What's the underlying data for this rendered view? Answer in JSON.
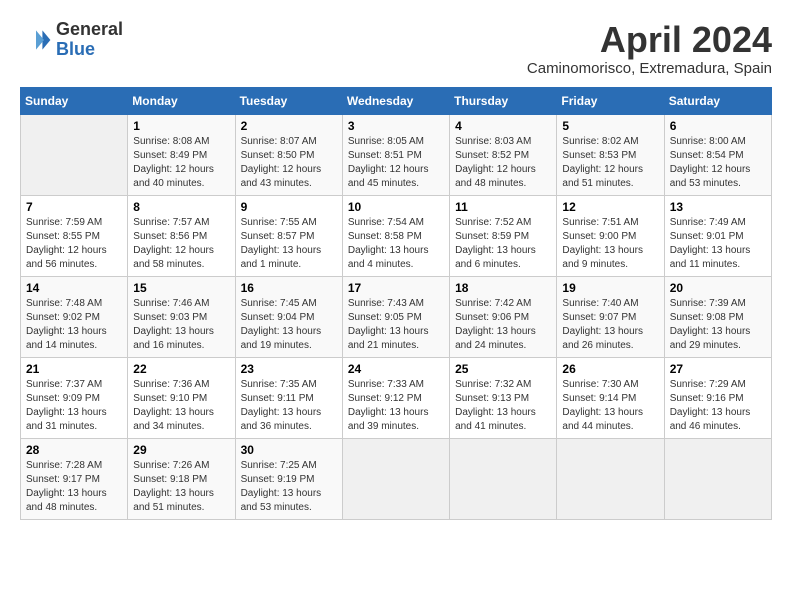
{
  "header": {
    "logo_general": "General",
    "logo_blue": "Blue",
    "month_title": "April 2024",
    "subtitle": "Caminomorisco, Extremadura, Spain"
  },
  "weekdays": [
    "Sunday",
    "Monday",
    "Tuesday",
    "Wednesday",
    "Thursday",
    "Friday",
    "Saturday"
  ],
  "weeks": [
    [
      {
        "day": "",
        "sunrise": "",
        "sunset": "",
        "daylight": ""
      },
      {
        "day": "1",
        "sunrise": "Sunrise: 8:08 AM",
        "sunset": "Sunset: 8:49 PM",
        "daylight": "Daylight: 12 hours and 40 minutes."
      },
      {
        "day": "2",
        "sunrise": "Sunrise: 8:07 AM",
        "sunset": "Sunset: 8:50 PM",
        "daylight": "Daylight: 12 hours and 43 minutes."
      },
      {
        "day": "3",
        "sunrise": "Sunrise: 8:05 AM",
        "sunset": "Sunset: 8:51 PM",
        "daylight": "Daylight: 12 hours and 45 minutes."
      },
      {
        "day": "4",
        "sunrise": "Sunrise: 8:03 AM",
        "sunset": "Sunset: 8:52 PM",
        "daylight": "Daylight: 12 hours and 48 minutes."
      },
      {
        "day": "5",
        "sunrise": "Sunrise: 8:02 AM",
        "sunset": "Sunset: 8:53 PM",
        "daylight": "Daylight: 12 hours and 51 minutes."
      },
      {
        "day": "6",
        "sunrise": "Sunrise: 8:00 AM",
        "sunset": "Sunset: 8:54 PM",
        "daylight": "Daylight: 12 hours and 53 minutes."
      }
    ],
    [
      {
        "day": "7",
        "sunrise": "Sunrise: 7:59 AM",
        "sunset": "Sunset: 8:55 PM",
        "daylight": "Daylight: 12 hours and 56 minutes."
      },
      {
        "day": "8",
        "sunrise": "Sunrise: 7:57 AM",
        "sunset": "Sunset: 8:56 PM",
        "daylight": "Daylight: 12 hours and 58 minutes."
      },
      {
        "day": "9",
        "sunrise": "Sunrise: 7:55 AM",
        "sunset": "Sunset: 8:57 PM",
        "daylight": "Daylight: 13 hours and 1 minute."
      },
      {
        "day": "10",
        "sunrise": "Sunrise: 7:54 AM",
        "sunset": "Sunset: 8:58 PM",
        "daylight": "Daylight: 13 hours and 4 minutes."
      },
      {
        "day": "11",
        "sunrise": "Sunrise: 7:52 AM",
        "sunset": "Sunset: 8:59 PM",
        "daylight": "Daylight: 13 hours and 6 minutes."
      },
      {
        "day": "12",
        "sunrise": "Sunrise: 7:51 AM",
        "sunset": "Sunset: 9:00 PM",
        "daylight": "Daylight: 13 hours and 9 minutes."
      },
      {
        "day": "13",
        "sunrise": "Sunrise: 7:49 AM",
        "sunset": "Sunset: 9:01 PM",
        "daylight": "Daylight: 13 hours and 11 minutes."
      }
    ],
    [
      {
        "day": "14",
        "sunrise": "Sunrise: 7:48 AM",
        "sunset": "Sunset: 9:02 PM",
        "daylight": "Daylight: 13 hours and 14 minutes."
      },
      {
        "day": "15",
        "sunrise": "Sunrise: 7:46 AM",
        "sunset": "Sunset: 9:03 PM",
        "daylight": "Daylight: 13 hours and 16 minutes."
      },
      {
        "day": "16",
        "sunrise": "Sunrise: 7:45 AM",
        "sunset": "Sunset: 9:04 PM",
        "daylight": "Daylight: 13 hours and 19 minutes."
      },
      {
        "day": "17",
        "sunrise": "Sunrise: 7:43 AM",
        "sunset": "Sunset: 9:05 PM",
        "daylight": "Daylight: 13 hours and 21 minutes."
      },
      {
        "day": "18",
        "sunrise": "Sunrise: 7:42 AM",
        "sunset": "Sunset: 9:06 PM",
        "daylight": "Daylight: 13 hours and 24 minutes."
      },
      {
        "day": "19",
        "sunrise": "Sunrise: 7:40 AM",
        "sunset": "Sunset: 9:07 PM",
        "daylight": "Daylight: 13 hours and 26 minutes."
      },
      {
        "day": "20",
        "sunrise": "Sunrise: 7:39 AM",
        "sunset": "Sunset: 9:08 PM",
        "daylight": "Daylight: 13 hours and 29 minutes."
      }
    ],
    [
      {
        "day": "21",
        "sunrise": "Sunrise: 7:37 AM",
        "sunset": "Sunset: 9:09 PM",
        "daylight": "Daylight: 13 hours and 31 minutes."
      },
      {
        "day": "22",
        "sunrise": "Sunrise: 7:36 AM",
        "sunset": "Sunset: 9:10 PM",
        "daylight": "Daylight: 13 hours and 34 minutes."
      },
      {
        "day": "23",
        "sunrise": "Sunrise: 7:35 AM",
        "sunset": "Sunset: 9:11 PM",
        "daylight": "Daylight: 13 hours and 36 minutes."
      },
      {
        "day": "24",
        "sunrise": "Sunrise: 7:33 AM",
        "sunset": "Sunset: 9:12 PM",
        "daylight": "Daylight: 13 hours and 39 minutes."
      },
      {
        "day": "25",
        "sunrise": "Sunrise: 7:32 AM",
        "sunset": "Sunset: 9:13 PM",
        "daylight": "Daylight: 13 hours and 41 minutes."
      },
      {
        "day": "26",
        "sunrise": "Sunrise: 7:30 AM",
        "sunset": "Sunset: 9:14 PM",
        "daylight": "Daylight: 13 hours and 44 minutes."
      },
      {
        "day": "27",
        "sunrise": "Sunrise: 7:29 AM",
        "sunset": "Sunset: 9:16 PM",
        "daylight": "Daylight: 13 hours and 46 minutes."
      }
    ],
    [
      {
        "day": "28",
        "sunrise": "Sunrise: 7:28 AM",
        "sunset": "Sunset: 9:17 PM",
        "daylight": "Daylight: 13 hours and 48 minutes."
      },
      {
        "day": "29",
        "sunrise": "Sunrise: 7:26 AM",
        "sunset": "Sunset: 9:18 PM",
        "daylight": "Daylight: 13 hours and 51 minutes."
      },
      {
        "day": "30",
        "sunrise": "Sunrise: 7:25 AM",
        "sunset": "Sunset: 9:19 PM",
        "daylight": "Daylight: 13 hours and 53 minutes."
      },
      {
        "day": "",
        "sunrise": "",
        "sunset": "",
        "daylight": ""
      },
      {
        "day": "",
        "sunrise": "",
        "sunset": "",
        "daylight": ""
      },
      {
        "day": "",
        "sunrise": "",
        "sunset": "",
        "daylight": ""
      },
      {
        "day": "",
        "sunrise": "",
        "sunset": "",
        "daylight": ""
      }
    ]
  ]
}
